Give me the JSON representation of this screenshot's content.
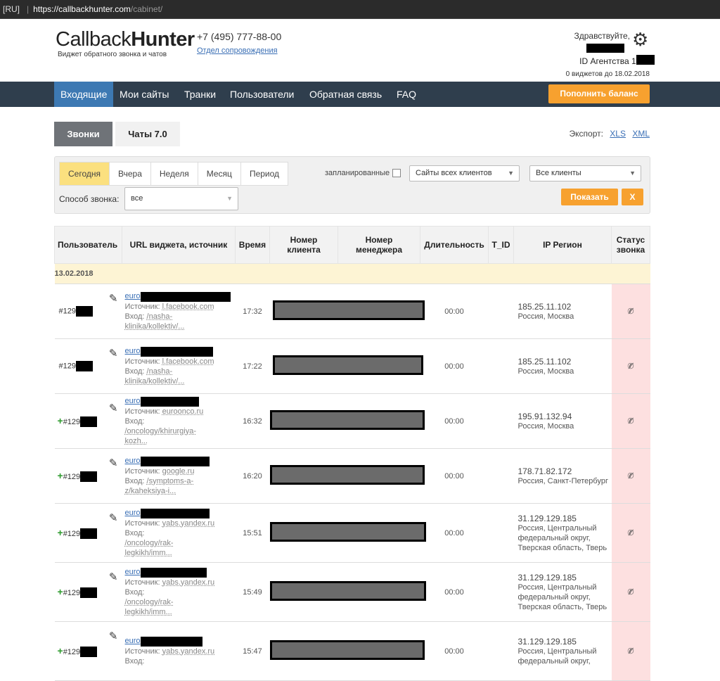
{
  "browser": {
    "lang": "[RU]",
    "separator": "|",
    "url_host": "https://callbackhunter.com",
    "url_path": "/cabinet/"
  },
  "header": {
    "logo_light": "Callback",
    "logo_bold": "Hunter",
    "logo_sub": "Виджет обратного звонка и чатов",
    "phone": "+7 (495) 777-88-00",
    "support_link": "Отдел сопровождения",
    "greeting": "Здравствуйте,",
    "agency_id": "ID Агентства 129-",
    "widgets_until": "0 виджетов до 18.02.2018"
  },
  "nav": {
    "items": [
      "Входящие",
      "Мои сайты",
      "Транки",
      "Пользователи",
      "Обратная связь",
      "FAQ"
    ],
    "topup": "Пополнить баланс"
  },
  "tabs": {
    "calls": "Звонки",
    "chats": "Чаты 7.0"
  },
  "export": {
    "label": "Экспорт:",
    "xls": "XLS",
    "xml": "XML"
  },
  "filters": {
    "periods": [
      "Сегодня",
      "Вчера",
      "Неделя",
      "Месяц",
      "Период"
    ],
    "selected_period": "Сегодня",
    "scheduled": "запланированные",
    "sites": "Сайты всех клиентов",
    "clients": "Все клиенты",
    "method_label": "Способ звонка:",
    "method_value": "все",
    "show": "Показать",
    "clear": "X"
  },
  "table": {
    "headers": [
      "Пользователь",
      "URL виджета, источник",
      "Время",
      "Номер клиента",
      "Номер менеджера",
      "Длительность",
      "T_ID",
      "IP Регион",
      "Статус звонка"
    ],
    "date": "13.02.2018",
    "rows": [
      {
        "plus": false,
        "uid": "#129",
        "url": "euro",
        "source_label": "Источник:",
        "source": "l.facebook.com",
        "entry_label": "Вход:",
        "entry": "/nasha-klinika/kollektiv/...",
        "time": "17:32",
        "duration": "00:00",
        "ip": "185.25.11.102",
        "region": "Россия, Москва"
      },
      {
        "plus": false,
        "uid": "#129",
        "url": "euro",
        "source_label": "Источник:",
        "source": "l.facebook.com",
        "entry_label": "Вход:",
        "entry": "/nasha-klinika/kollektiv/...",
        "time": "17:22",
        "duration": "00:00",
        "ip": "185.25.11.102",
        "region": "Россия, Москва"
      },
      {
        "plus": true,
        "uid": "#129",
        "url": "euro",
        "source_label": "Источник:",
        "source": "euroonco.ru",
        "entry_label": "Вход:",
        "entry": "/oncology/khirurgiya-kozh...",
        "time": "16:32",
        "duration": "00:00",
        "ip": "195.91.132.94",
        "region": "Россия, Москва"
      },
      {
        "plus": true,
        "uid": "#129",
        "url": "euro",
        "source_label": "Источник:",
        "source": "google.ru",
        "entry_label": "Вход:",
        "entry": "/symptoms-a-z/kaheksiya-i...",
        "time": "16:20",
        "duration": "00:00",
        "ip": "178.71.82.172",
        "region": "Россия, Санкт-Петербург"
      },
      {
        "plus": true,
        "uid": "#129",
        "url": "euro",
        "source_label": "Источник:",
        "source": "yabs.yandex.ru",
        "entry_label": "Вход:",
        "entry": "/oncology/rak-legkikh/imm...",
        "time": "15:51",
        "duration": "00:00",
        "ip": "31.129.129.185",
        "region": "Россия, Центральный федеральный округ, Тверская область, Тверь"
      },
      {
        "plus": true,
        "uid": "#129",
        "url": "euro",
        "source_label": "Источник:",
        "source": "yabs.yandex.ru",
        "entry_label": "Вход:",
        "entry": "/oncology/rak-legkikh/imm...",
        "time": "15:49",
        "duration": "00:00",
        "ip": "31.129.129.185",
        "region": "Россия, Центральный федеральный округ, Тверская область, Тверь"
      },
      {
        "plus": true,
        "uid": "#129",
        "url": "euro",
        "source_label": "Источник:",
        "source": "yabs.yandex.ru",
        "entry_label": "Вход:",
        "entry": "",
        "time": "15:47",
        "duration": "00:00",
        "ip": "31.129.129.185",
        "region": "Россия, Центральный федеральный округ,"
      }
    ]
  },
  "colors": {
    "nav_bg": "#2f3e4d",
    "nav_active": "#3d79b3",
    "accent": "#f7a12f",
    "status_bg": "#fde0e0"
  }
}
